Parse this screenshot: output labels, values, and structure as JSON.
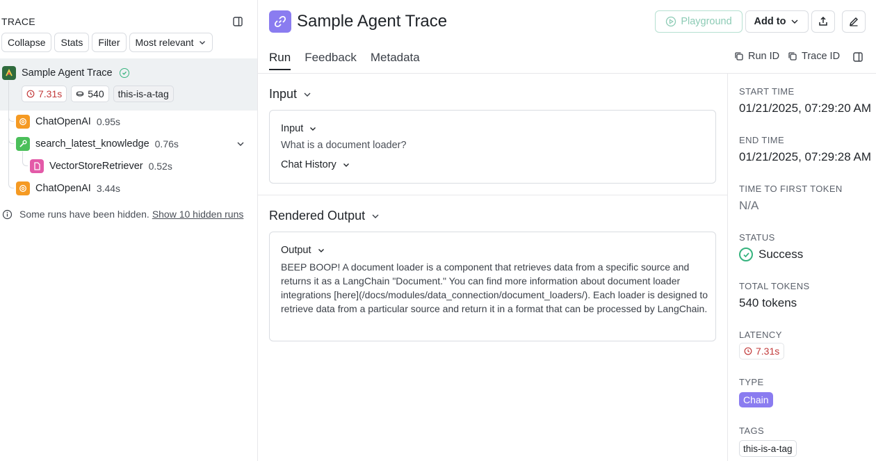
{
  "sidebar": {
    "title": "TRACE",
    "buttons": {
      "collapse": "Collapse",
      "stats": "Stats",
      "filter": "Filter",
      "sort": "Most relevant"
    },
    "root": {
      "name": "Sample Agent Trace",
      "latency": "7.31s",
      "tokens": "540",
      "tag": "this-is-a-tag"
    },
    "runs": [
      {
        "name": "ChatOpenAI",
        "latency": "0.95s"
      },
      {
        "name": "search_latest_knowledge",
        "latency": "0.76s"
      },
      {
        "name": "VectorStoreRetriever",
        "latency": "0.52s"
      },
      {
        "name": "ChatOpenAI",
        "latency": "3.44s"
      }
    ],
    "hidden_note": "Some runs have been hidden.",
    "hidden_link": "Show 10 hidden runs"
  },
  "header": {
    "title": "Sample Agent Trace",
    "playground": "Playground",
    "add_to": "Add to",
    "tabs": [
      "Run",
      "Feedback",
      "Metadata"
    ],
    "run_id": "Run ID",
    "trace_id": "Trace ID"
  },
  "main": {
    "input_section": "Input",
    "input_label": "Input",
    "input_value": "What is a document loader?",
    "chat_history": "Chat History",
    "output_section": "Rendered Output",
    "output_label": "Output",
    "output_text": "BEEP BOOP! A document loader is a component that retrieves data from a specific source and returns it as a LangChain \"Document.\" You can find more information about document loader integrations [here](/docs/modules/data_connection/document_loaders/). Each loader is designed to retrieve data from a particular source and return it in a format that can be processed by LangChain."
  },
  "meta": {
    "start_time_label": "START TIME",
    "start_time": "01/21/2025, 07:29:20 AM",
    "end_time_label": "END TIME",
    "end_time": "01/21/2025, 07:29:28 AM",
    "ttft_label": "TIME TO FIRST TOKEN",
    "ttft": "N/A",
    "status_label": "STATUS",
    "status": "Success",
    "tokens_label": "TOTAL TOKENS",
    "tokens": "540 tokens",
    "latency_label": "LATENCY",
    "latency": "7.31s",
    "type_label": "TYPE",
    "type": "Chain",
    "tags_label": "TAGS",
    "tag": "this-is-a-tag"
  },
  "colors": {
    "accent_purple": "#8a7cf0",
    "success_green": "#36b37e",
    "latency_red": "#c23a3a",
    "llm_orange": "#f59a23",
    "tool_green": "#4bbf5a",
    "retriever_pink": "#e35aa8"
  }
}
